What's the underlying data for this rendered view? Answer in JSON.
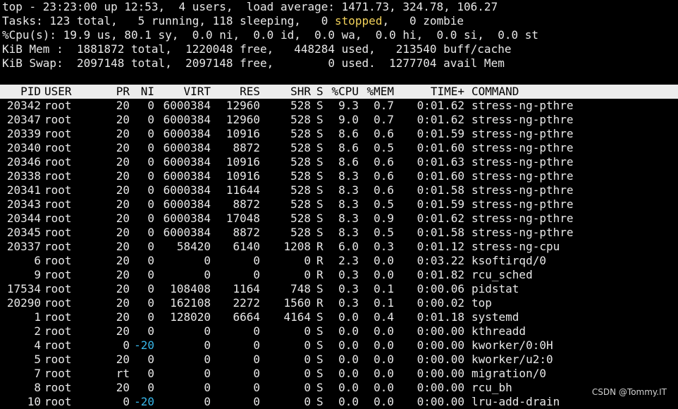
{
  "summary": {
    "line1": "top - 23:23:00 up 12:53,  4 users,  load average: 1471.73, 324.78, 106.27",
    "tasks_a": "Tasks: 123 total,   5 running, 118 sleeping,   0 ",
    "tasks_stopped": "stopped",
    "tasks_b": ",   0 zombie",
    "cpu": "%Cpu(s): 19.9 us, 80.1 sy,  0.0 ni,  0.0 id,  0.0 wa,  0.0 hi,  0.0 si,  0.0 st",
    "mem": "KiB Mem :  1881872 total,  1220048 free,   448284 used,   213540 buff/cache",
    "swap": "KiB Swap:  2097148 total,  2097148 free,        0 used.  1277704 avail Mem"
  },
  "columns": {
    "pid": "PID",
    "user": "USER",
    "pr": "PR",
    "ni": "NI",
    "virt": "VIRT",
    "res": "RES",
    "shr": "SHR",
    "s": "S",
    "cpu": "%CPU",
    "mem": "%MEM",
    "time": "TIME+",
    "command": "COMMAND"
  },
  "colors": {
    "stopped": "#f3d25a",
    "negative_ni": "#37b6e8",
    "header_bg": "#ececec"
  },
  "rows": [
    {
      "pid": "20342",
      "user": "root",
      "pr": "20",
      "ni": "0",
      "virt": "6000384",
      "res": "12960",
      "shr": "528",
      "s": "S",
      "cpu": "9.3",
      "mem": "0.7",
      "time": "0:01.62",
      "command": "stress-ng-pthre"
    },
    {
      "pid": "20347",
      "user": "root",
      "pr": "20",
      "ni": "0",
      "virt": "6000384",
      "res": "12960",
      "shr": "528",
      "s": "S",
      "cpu": "9.0",
      "mem": "0.7",
      "time": "0:01.62",
      "command": "stress-ng-pthre"
    },
    {
      "pid": "20339",
      "user": "root",
      "pr": "20",
      "ni": "0",
      "virt": "6000384",
      "res": "10916",
      "shr": "528",
      "s": "S",
      "cpu": "8.6",
      "mem": "0.6",
      "time": "0:01.59",
      "command": "stress-ng-pthre"
    },
    {
      "pid": "20340",
      "user": "root",
      "pr": "20",
      "ni": "0",
      "virt": "6000384",
      "res": "8872",
      "shr": "528",
      "s": "S",
      "cpu": "8.6",
      "mem": "0.5",
      "time": "0:01.60",
      "command": "stress-ng-pthre"
    },
    {
      "pid": "20346",
      "user": "root",
      "pr": "20",
      "ni": "0",
      "virt": "6000384",
      "res": "10916",
      "shr": "528",
      "s": "S",
      "cpu": "8.6",
      "mem": "0.6",
      "time": "0:01.63",
      "command": "stress-ng-pthre"
    },
    {
      "pid": "20338",
      "user": "root",
      "pr": "20",
      "ni": "0",
      "virt": "6000384",
      "res": "10916",
      "shr": "528",
      "s": "S",
      "cpu": "8.3",
      "mem": "0.6",
      "time": "0:01.60",
      "command": "stress-ng-pthre"
    },
    {
      "pid": "20341",
      "user": "root",
      "pr": "20",
      "ni": "0",
      "virt": "6000384",
      "res": "11644",
      "shr": "528",
      "s": "S",
      "cpu": "8.3",
      "mem": "0.6",
      "time": "0:01.58",
      "command": "stress-ng-pthre"
    },
    {
      "pid": "20343",
      "user": "root",
      "pr": "20",
      "ni": "0",
      "virt": "6000384",
      "res": "8872",
      "shr": "528",
      "s": "S",
      "cpu": "8.3",
      "mem": "0.5",
      "time": "0:01.59",
      "command": "stress-ng-pthre"
    },
    {
      "pid": "20344",
      "user": "root",
      "pr": "20",
      "ni": "0",
      "virt": "6000384",
      "res": "17048",
      "shr": "528",
      "s": "S",
      "cpu": "8.3",
      "mem": "0.9",
      "time": "0:01.62",
      "command": "stress-ng-pthre"
    },
    {
      "pid": "20345",
      "user": "root",
      "pr": "20",
      "ni": "0",
      "virt": "6000384",
      "res": "8872",
      "shr": "528",
      "s": "S",
      "cpu": "8.3",
      "mem": "0.5",
      "time": "0:01.58",
      "command": "stress-ng-pthre"
    },
    {
      "pid": "20337",
      "user": "root",
      "pr": "20",
      "ni": "0",
      "virt": "58420",
      "res": "6140",
      "shr": "1208",
      "s": "R",
      "cpu": "6.0",
      "mem": "0.3",
      "time": "0:01.12",
      "command": "stress-ng-cpu"
    },
    {
      "pid": "6",
      "user": "root",
      "pr": "20",
      "ni": "0",
      "virt": "0",
      "res": "0",
      "shr": "0",
      "s": "R",
      "cpu": "2.3",
      "mem": "0.0",
      "time": "0:03.22",
      "command": "ksoftirqd/0"
    },
    {
      "pid": "9",
      "user": "root",
      "pr": "20",
      "ni": "0",
      "virt": "0",
      "res": "0",
      "shr": "0",
      "s": "R",
      "cpu": "0.3",
      "mem": "0.0",
      "time": "0:01.82",
      "command": "rcu_sched"
    },
    {
      "pid": "17534",
      "user": "root",
      "pr": "20",
      "ni": "0",
      "virt": "108408",
      "res": "1164",
      "shr": "748",
      "s": "S",
      "cpu": "0.3",
      "mem": "0.1",
      "time": "0:00.06",
      "command": "pidstat"
    },
    {
      "pid": "20290",
      "user": "root",
      "pr": "20",
      "ni": "0",
      "virt": "162108",
      "res": "2272",
      "shr": "1560",
      "s": "R",
      "cpu": "0.3",
      "mem": "0.1",
      "time": "0:00.02",
      "command": "top"
    },
    {
      "pid": "1",
      "user": "root",
      "pr": "20",
      "ni": "0",
      "virt": "128020",
      "res": "6664",
      "shr": "4164",
      "s": "S",
      "cpu": "0.0",
      "mem": "0.4",
      "time": "0:01.18",
      "command": "systemd"
    },
    {
      "pid": "2",
      "user": "root",
      "pr": "20",
      "ni": "0",
      "virt": "0",
      "res": "0",
      "shr": "0",
      "s": "S",
      "cpu": "0.0",
      "mem": "0.0",
      "time": "0:00.00",
      "command": "kthreadd"
    },
    {
      "pid": "4",
      "user": "root",
      "pr": "0",
      "ni": "-20",
      "virt": "0",
      "res": "0",
      "shr": "0",
      "s": "S",
      "cpu": "0.0",
      "mem": "0.0",
      "time": "0:00.00",
      "command": "kworker/0:0H"
    },
    {
      "pid": "5",
      "user": "root",
      "pr": "20",
      "ni": "0",
      "virt": "0",
      "res": "0",
      "shr": "0",
      "s": "S",
      "cpu": "0.0",
      "mem": "0.0",
      "time": "0:00.00",
      "command": "kworker/u2:0"
    },
    {
      "pid": "7",
      "user": "root",
      "pr": "rt",
      "ni": "0",
      "virt": "0",
      "res": "0",
      "shr": "0",
      "s": "S",
      "cpu": "0.0",
      "mem": "0.0",
      "time": "0:00.00",
      "command": "migration/0"
    },
    {
      "pid": "8",
      "user": "root",
      "pr": "20",
      "ni": "0",
      "virt": "0",
      "res": "0",
      "shr": "0",
      "s": "S",
      "cpu": "0.0",
      "mem": "0.0",
      "time": "0:00.00",
      "command": "rcu_bh"
    },
    {
      "pid": "10",
      "user": "root",
      "pr": "0",
      "ni": "-20",
      "virt": "0",
      "res": "0",
      "shr": "0",
      "s": "S",
      "cpu": "0.0",
      "mem": "0.0",
      "time": "0:00.00",
      "command": "lru-add-drain"
    }
  ],
  "watermark": "CSDN @Tommy.IT"
}
